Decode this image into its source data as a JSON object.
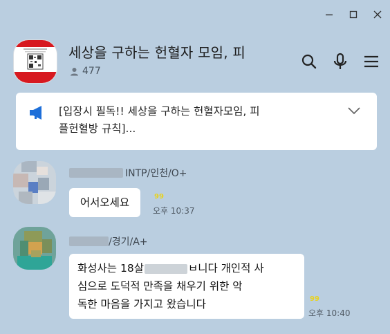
{
  "window": {
    "controls": [
      "minimize",
      "maximize",
      "close"
    ]
  },
  "room": {
    "title": "세상을 구하는 헌혈자 모임, 피",
    "member_count": "477",
    "accent_color": "#d71920"
  },
  "notice": {
    "text": "[입장시 필독!! 세상을 구하는 헌혈자모임, 피\n플헌혈방 규칙]..."
  },
  "messages": [
    {
      "sender_suffix": "INTP/인천/O+",
      "text": "어서오세요",
      "unread": "99",
      "time": "오후 10:37"
    },
    {
      "sender_suffix": "/경기/A+",
      "text_part1": "화성사는 18살",
      "text_part2": "ㅂ니다 개인적 사",
      "text_line2": "심으로 도덕적 만족을 채우기 위한 악",
      "text_line3": "독한 마음을 가지고 왔습니다",
      "unread": "99",
      "time": "오후 10:40"
    }
  ]
}
